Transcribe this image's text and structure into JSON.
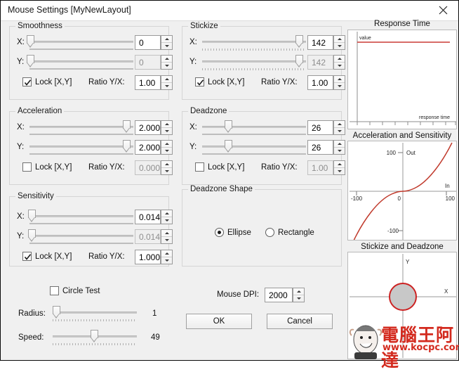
{
  "window": {
    "title": "Mouse Settings [MyNewLayout]",
    "close_icon": "close-icon"
  },
  "groups": {
    "smoothness": {
      "legend": "Smoothness",
      "x_label": "X:",
      "y_label": "Y:",
      "x_value": "0",
      "y_value": "0",
      "x_slider_pct": 1,
      "y_slider_pct": 1,
      "y_disabled": true,
      "lock_label": "Lock [X,Y]",
      "lock_checked": true,
      "ratio_label": "Ratio Y/X:",
      "ratio_value": "1.00",
      "ratio_disabled": false
    },
    "stickize": {
      "legend": "Stickize",
      "x_label": "X:",
      "y_label": "Y:",
      "x_value": "142",
      "y_value": "142",
      "x_slider_pct": 93,
      "y_slider_pct": 93,
      "y_disabled": true,
      "lock_label": "Lock [X,Y]",
      "lock_checked": true,
      "ratio_label": "Ratio Y/X:",
      "ratio_value": "1.00",
      "ratio_disabled": false
    },
    "acceleration": {
      "legend": "Acceleration",
      "x_label": "X:",
      "y_label": "Y:",
      "x_value": "2.000",
      "y_value": "2.000",
      "x_slider_pct": 93,
      "y_slider_pct": 93,
      "y_disabled": false,
      "lock_label": "Lock [X,Y]",
      "lock_checked": false,
      "ratio_label": "Ratio Y/X:",
      "ratio_value": "0.000",
      "ratio_disabled": true
    },
    "deadzone": {
      "legend": "Deadzone",
      "x_label": "X:",
      "y_label": "Y:",
      "x_value": "26",
      "y_value": "26",
      "x_slider_pct": 25,
      "y_slider_pct": 25,
      "y_disabled": false,
      "lock_label": "Lock [X,Y]",
      "lock_checked": false,
      "ratio_label": "Ratio Y/X:",
      "ratio_value": "1.00",
      "ratio_disabled": true
    },
    "sensitivity": {
      "legend": "Sensitivity",
      "x_label": "X:",
      "y_label": "Y:",
      "x_value": "0.014",
      "y_value": "0.014",
      "x_slider_pct": 2,
      "y_slider_pct": 2,
      "y_disabled": true,
      "lock_label": "Lock [X,Y]",
      "lock_checked": true,
      "ratio_label": "Ratio Y/X:",
      "ratio_value": "1.000",
      "ratio_disabled": false
    },
    "deadzone_shape": {
      "legend": "Deadzone Shape",
      "options": [
        {
          "label": "Ellipse",
          "selected": true
        },
        {
          "label": "Rectangle",
          "selected": false
        }
      ]
    }
  },
  "bottom": {
    "circle_test_label": "Circle Test",
    "circle_test_checked": false,
    "radius_label": "Radius:",
    "radius_value": "1",
    "radius_pct": 4,
    "speed_label": "Speed:",
    "speed_value": "49",
    "speed_pct": 49,
    "dpi_label": "Mouse DPI:",
    "dpi_value": "2000",
    "ok_label": "OK",
    "cancel_label": "Cancel"
  },
  "charts": [
    {
      "title": "Response Time",
      "type": "line",
      "y_axis_label": "value",
      "x_axis_label": "response time",
      "series_color": "#d04040",
      "line_level_pct": 8,
      "xticks": 9
    },
    {
      "title": "Acceleration and Sensitivity",
      "type": "line",
      "y_axis_label": "Out",
      "x_axis_label": "In",
      "series_color": "#c0392b",
      "ytick_top": "100",
      "ytick_zero": "0",
      "ytick_bottom": "-100",
      "xtick_left": "-100",
      "xtick_right": "100"
    },
    {
      "title": "Stickize and Deadzone",
      "type": "scatter",
      "y_axis_label": "Y",
      "x_axis_label": "X",
      "deadzone_circle_color": "#cc2222",
      "deadzone_fill": "#c8c8c8"
    }
  ],
  "watermark": {
    "brand": "電腦王阿達",
    "url": "www.kocpc.com.tw"
  }
}
